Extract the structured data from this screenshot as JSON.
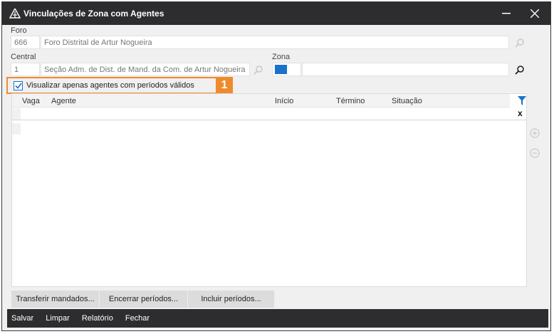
{
  "window": {
    "title": "Vinculações de Zona com Agentes",
    "minimize_glyph": "—",
    "close_glyph": "✕"
  },
  "foro": {
    "label": "Foro",
    "code": "666",
    "name": "Foro Distrital de Artur Nogueira",
    "lookup_icon": "search-icon"
  },
  "central": {
    "label": "Central",
    "code": "1",
    "name": "Seção Adm. de Dist. de Mand. da Com. de Artur Nogueira",
    "lookup_icon": "search-icon"
  },
  "zona": {
    "label": "Zona",
    "color": "#1a73c9",
    "value": "",
    "lookup_icon": "search-icon"
  },
  "filter_checkbox": {
    "label": "Visualizar apenas agentes com períodos válidos",
    "checked": true,
    "highlight_color": "#ef8b2c",
    "badge": "1"
  },
  "grid": {
    "columns": [
      "Vaga",
      "Agente",
      "Início",
      "Término",
      "Situação"
    ],
    "filter_icon": "funnel-icon",
    "clear_filter_glyph": "x",
    "rows": []
  },
  "side_actions": {
    "add_icon": "plus-circle-icon",
    "remove_icon": "minus-circle-icon"
  },
  "actions": [
    "Transferir mandados...",
    "Encerrar períodos...",
    "Incluir períodos..."
  ],
  "footer": [
    "Salvar",
    "Limpar",
    "Relatório",
    "Fechar"
  ]
}
